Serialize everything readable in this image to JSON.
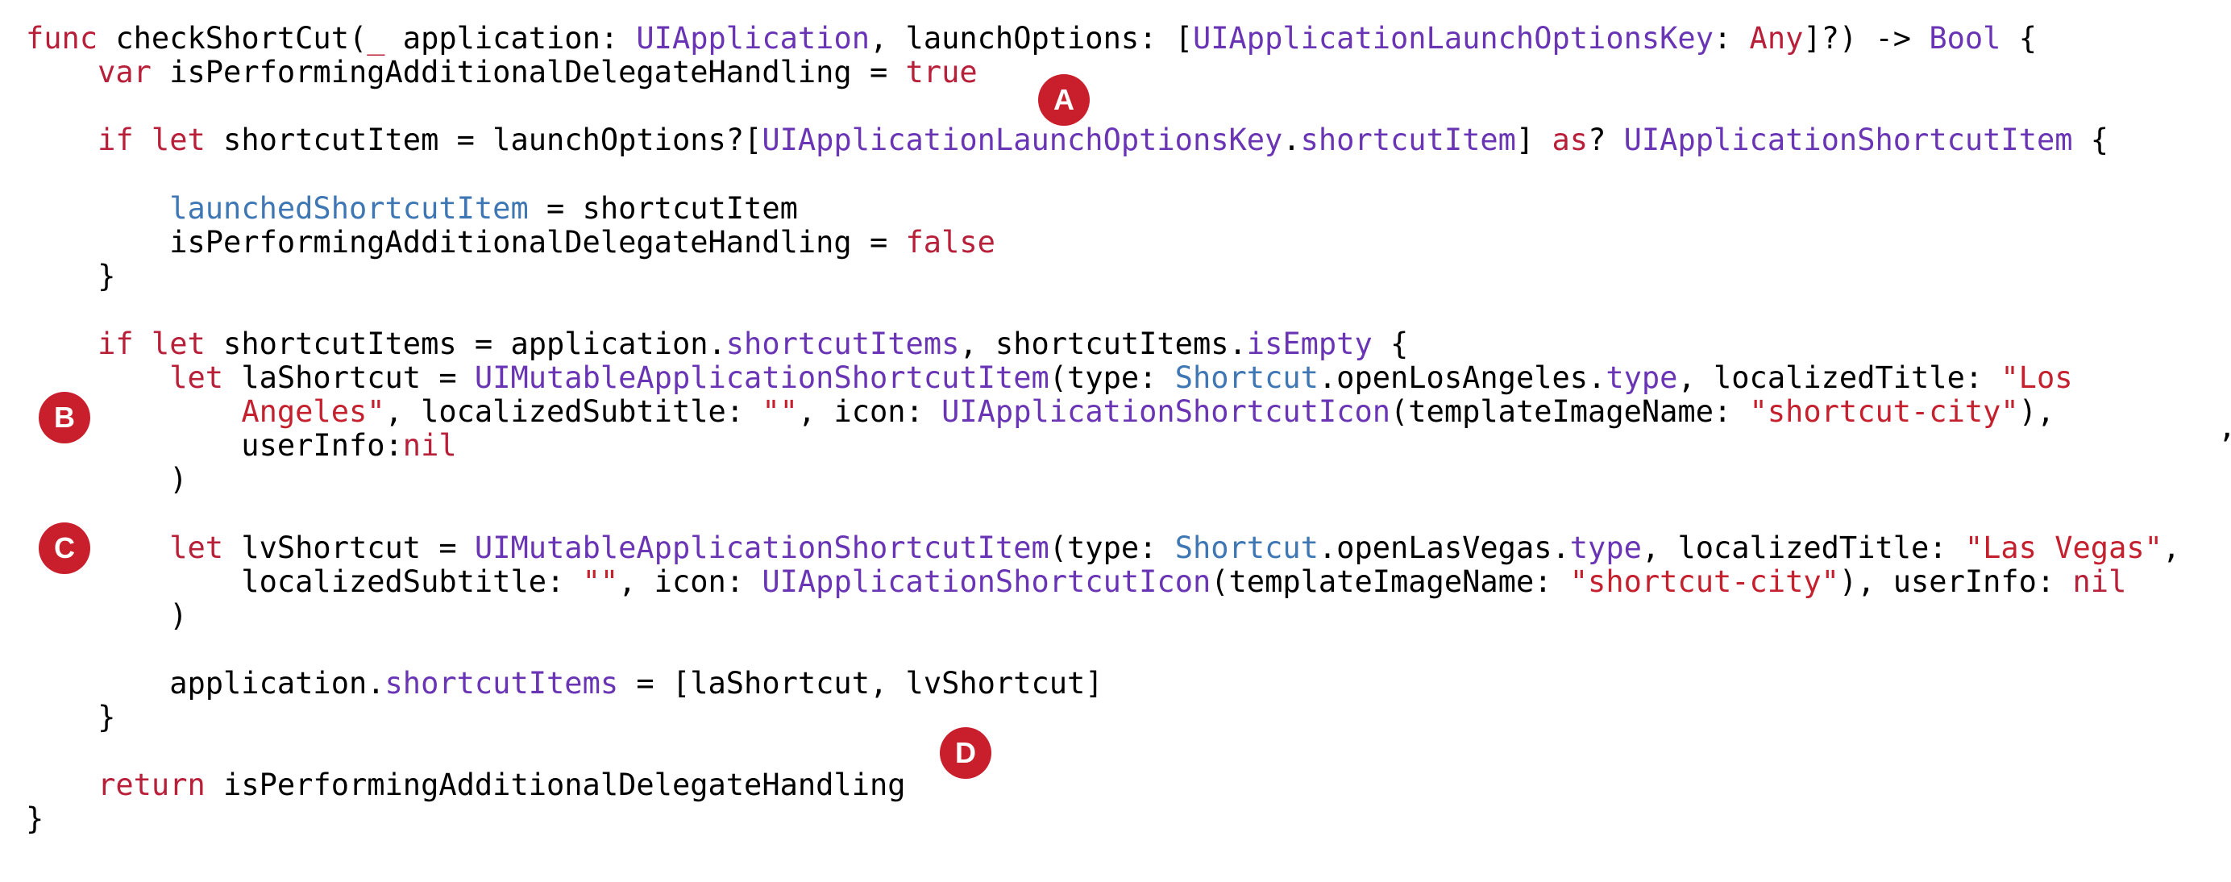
{
  "colors": {
    "background": "#ffffff",
    "plain": "#000000",
    "keyword": "#b8203a",
    "type": "#6a35b5",
    "string": "#c4202e",
    "property": "#3e77b4",
    "method": "#6a35b5",
    "marker": "#c91f2c"
  },
  "code": {
    "lines": [
      [
        [
          "keyword",
          "func"
        ],
        [
          "plain",
          " checkShortCut("
        ],
        [
          "keyword",
          "_"
        ],
        [
          "plain",
          " application: "
        ],
        [
          "type",
          "UIApplication"
        ],
        [
          "plain",
          ", launchOptions: ["
        ],
        [
          "type",
          "UIApplicationLaunchOptionsKey"
        ],
        [
          "plain",
          ": "
        ],
        [
          "keyword",
          "Any"
        ],
        [
          "plain",
          "]?) -> "
        ],
        [
          "type",
          "Bool"
        ],
        [
          "plain",
          " {"
        ]
      ],
      [
        [
          "plain",
          "    "
        ],
        [
          "keyword",
          "var"
        ],
        [
          "plain",
          " isPerformingAdditionalDelegateHandling = "
        ],
        [
          "keyword",
          "true"
        ]
      ],
      [],
      [
        [
          "plain",
          "    "
        ],
        [
          "keyword",
          "if let"
        ],
        [
          "plain",
          " shortcutItem = launchOptions?["
        ],
        [
          "type",
          "UIApplicationLaunchOptionsKey"
        ],
        [
          "plain",
          "."
        ],
        [
          "method",
          "shortcutItem"
        ],
        [
          "plain",
          "] "
        ],
        [
          "keyword",
          "as"
        ],
        [
          "plain",
          "? "
        ],
        [
          "type",
          "UIApplicationShortcutItem"
        ],
        [
          "plain",
          " {"
        ]
      ],
      [],
      [
        [
          "plain",
          "        "
        ],
        [
          "property",
          "launchedShortcutItem"
        ],
        [
          "plain",
          " = shortcutItem"
        ]
      ],
      [
        [
          "plain",
          "        isPerformingAdditionalDelegateHandling = "
        ],
        [
          "keyword",
          "false"
        ]
      ],
      [
        [
          "plain",
          "    }"
        ]
      ],
      [],
      [
        [
          "plain",
          "    "
        ],
        [
          "keyword",
          "if let"
        ],
        [
          "plain",
          " shortcutItems = application."
        ],
        [
          "method",
          "shortcutItems"
        ],
        [
          "plain",
          ", shortcutItems."
        ],
        [
          "method",
          "isEmpty"
        ],
        [
          "plain",
          " {"
        ]
      ],
      [
        [
          "plain",
          "        "
        ],
        [
          "keyword",
          "let"
        ],
        [
          "plain",
          " laShortcut = "
        ],
        [
          "type",
          "UIMutableApplicationShortcutItem"
        ],
        [
          "plain",
          "(type: "
        ],
        [
          "property",
          "Shortcut"
        ],
        [
          "plain",
          ".openLosAngeles."
        ],
        [
          "method",
          "type"
        ],
        [
          "plain",
          ", localizedTitle: "
        ],
        [
          "string",
          "\"Los"
        ]
      ],
      [
        [
          "plain",
          "            "
        ],
        [
          "string",
          "Angeles\""
        ],
        [
          "plain",
          ", localizedSubtitle: "
        ],
        [
          "string",
          "\"\""
        ],
        [
          "plain",
          ", icon: "
        ],
        [
          "type",
          "UIApplicationShortcutIcon"
        ],
        [
          "plain",
          "(templateImageName: "
        ],
        [
          "string",
          "\"shortcut-city\""
        ],
        [
          "plain",
          "),"
        ]
      ],
      [
        [
          "plain",
          "            userInfo:"
        ],
        [
          "keyword",
          "nil"
        ]
      ],
      [
        [
          "plain",
          "        )"
        ]
      ],
      [],
      [
        [
          "plain",
          "        "
        ],
        [
          "keyword",
          "let"
        ],
        [
          "plain",
          " lvShortcut = "
        ],
        [
          "type",
          "UIMutableApplicationShortcutItem"
        ],
        [
          "plain",
          "(type: "
        ],
        [
          "property",
          "Shortcut"
        ],
        [
          "plain",
          ".openLasVegas."
        ],
        [
          "method",
          "type"
        ],
        [
          "plain",
          ", localizedTitle: "
        ],
        [
          "string",
          "\"Las Vegas\""
        ],
        [
          "plain",
          ","
        ]
      ],
      [
        [
          "plain",
          "            localizedSubtitle: "
        ],
        [
          "string",
          "\"\""
        ],
        [
          "plain",
          ", icon: "
        ],
        [
          "type",
          "UIApplicationShortcutIcon"
        ],
        [
          "plain",
          "(templateImageName: "
        ],
        [
          "string",
          "\"shortcut-city\""
        ],
        [
          "plain",
          "), userInfo: "
        ],
        [
          "keyword",
          "nil"
        ]
      ],
      [
        [
          "plain",
          "        )"
        ]
      ],
      [],
      [
        [
          "plain",
          "        application."
        ],
        [
          "method",
          "shortcutItems"
        ],
        [
          "plain",
          " = [laShortcut, lvShortcut]"
        ]
      ],
      [
        [
          "plain",
          "    }"
        ]
      ],
      [],
      [
        [
          "plain",
          "    "
        ],
        [
          "keyword",
          "return"
        ],
        [
          "plain",
          " isPerformingAdditionalDelegateHandling"
        ]
      ],
      [
        [
          "plain",
          "}"
        ]
      ]
    ]
  },
  "markers": [
    {
      "label": "A"
    },
    {
      "label": "B"
    },
    {
      "label": "C"
    },
    {
      "label": "D"
    }
  ],
  "stray_comma": ","
}
